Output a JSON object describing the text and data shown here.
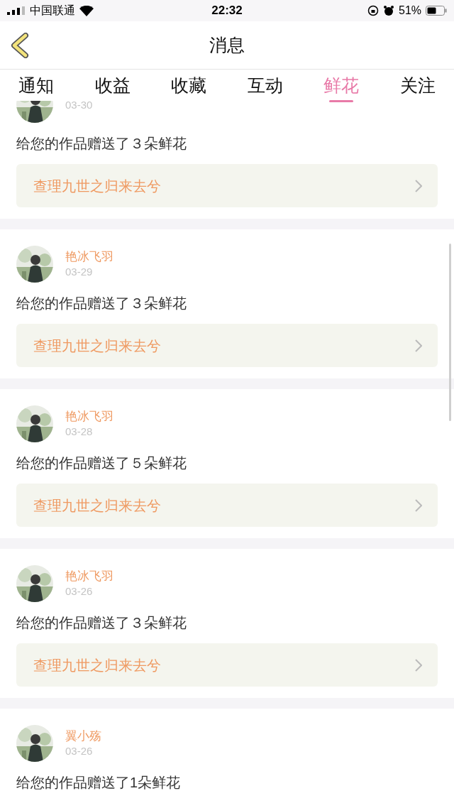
{
  "status_bar": {
    "carrier": "中国联通",
    "time": "22:32",
    "battery": "51%"
  },
  "nav": {
    "title": "消息"
  },
  "tabs": [
    {
      "label": "通知",
      "selected": false
    },
    {
      "label": "收益",
      "selected": false
    },
    {
      "label": "收藏",
      "selected": false
    },
    {
      "label": "互动",
      "selected": false
    },
    {
      "label": "鲜花",
      "selected": true
    },
    {
      "label": "关注",
      "selected": false
    }
  ],
  "messages": [
    {
      "date": "03-30",
      "text": "给您的作品赠送了３朵鲜花",
      "work": "查理九世之归来去兮"
    },
    {
      "user": "艳冰飞羽",
      "date": "03-29",
      "text": "给您的作品赠送了３朵鲜花",
      "work": "查理九世之归来去兮"
    },
    {
      "user": "艳冰飞羽",
      "date": "03-28",
      "text": "给您的作品赠送了５朵鲜花",
      "work": "查理九世之归来去兮"
    },
    {
      "user": "艳冰飞羽",
      "date": "03-26",
      "text": "给您的作品赠送了３朵鲜花",
      "work": "查理九世之归来去兮"
    },
    {
      "user": "翼小殇",
      "date": "03-26",
      "text": "给您的作品赠送了1朵鲜花"
    }
  ]
}
